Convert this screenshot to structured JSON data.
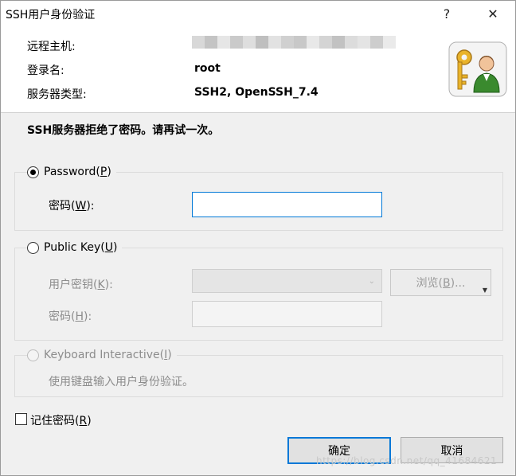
{
  "window": {
    "title": "SSH用户身份验证",
    "help_label": "?",
    "close_label": "✕"
  },
  "header": {
    "host_label": "远程主机:",
    "login_label": "登录名:",
    "login_value": "root",
    "server_type_label": "服务器类型:",
    "server_type_value": "SSH2, OpenSSH_7.4"
  },
  "message": "SSH服务器拒绝了密码。请再试一次。",
  "password_method": {
    "label_prefix": "Password(",
    "label_key": "P",
    "label_suffix": ")",
    "selected": true,
    "field_label_prefix": "密码(",
    "field_label_key": "W",
    "field_label_suffix": "):",
    "value": ""
  },
  "publickey_method": {
    "label_prefix": "Public Key(",
    "label_key": "U",
    "label_suffix": ")",
    "selected": false,
    "userkey_label_prefix": "用户密钥(",
    "userkey_label_key": "K",
    "userkey_label_suffix": "):",
    "browse_prefix": "浏览(",
    "browse_key": "B",
    "browse_suffix": ")...",
    "passphrase_label_prefix": "密码(",
    "passphrase_label_key": "H",
    "passphrase_label_suffix": "):"
  },
  "keyboard_method": {
    "label_prefix": "Keyboard Interactive(",
    "label_key": "I",
    "label_suffix": ")",
    "description": "使用键盘输入用户身份验证。"
  },
  "remember": {
    "label_prefix": "记住密码(",
    "label_key": "R",
    "label_suffix": ")",
    "checked": false
  },
  "buttons": {
    "ok": "确定",
    "cancel": "取消"
  },
  "watermark": "https://blog.csdn.net/qq_41684621",
  "colors": {
    "accent": "#0078d7",
    "body_bg": "#f0f0f0"
  }
}
